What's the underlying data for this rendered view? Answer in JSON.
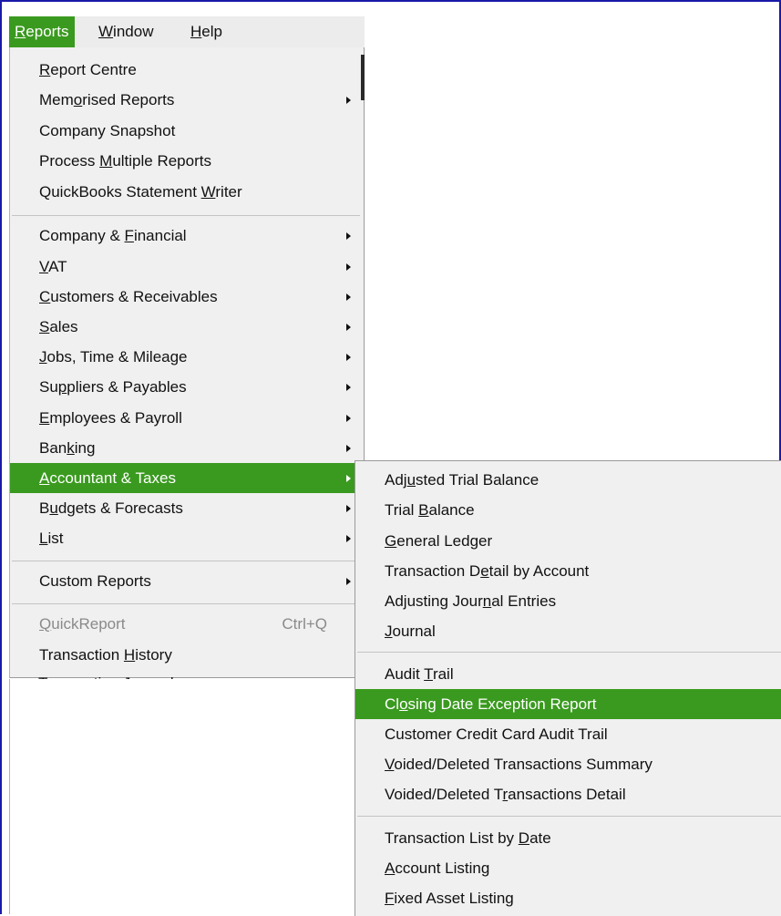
{
  "menubar": {
    "items": [
      {
        "pre": "",
        "u": "R",
        "post": "eports",
        "active": true
      },
      {
        "pre": "",
        "u": "W",
        "post": "indow",
        "active": false
      },
      {
        "pre": "",
        "u": "H",
        "post": "elp",
        "active": false
      }
    ]
  },
  "reports_menu": {
    "items": [
      {
        "pre": "",
        "u": "R",
        "post": "eport Centre",
        "submenu": false
      },
      {
        "pre": "Mem",
        "u": "o",
        "post": "rised Reports",
        "submenu": true
      },
      {
        "pre": "Company Snapshot",
        "u": "",
        "post": "",
        "submenu": false
      },
      {
        "pre": "Process ",
        "u": "M",
        "post": "ultiple Reports",
        "submenu": false
      },
      {
        "pre": "QuickBooks Statement ",
        "u": "W",
        "post": "riter",
        "submenu": false
      },
      {
        "pre": "Company & ",
        "u": "F",
        "post": "inancial",
        "submenu": true
      },
      {
        "pre": "",
        "u": "V",
        "post": "AT",
        "submenu": true
      },
      {
        "pre": "",
        "u": "C",
        "post": "ustomers & Receivables",
        "submenu": true
      },
      {
        "pre": "",
        "u": "S",
        "post": "ales",
        "submenu": true
      },
      {
        "pre": "",
        "u": "J",
        "post": "obs, Time & Mileage",
        "submenu": true
      },
      {
        "pre": "Su",
        "u": "p",
        "post": "pliers & Payables",
        "submenu": true
      },
      {
        "pre": "",
        "u": "E",
        "post": "mployees & Payroll",
        "submenu": true
      },
      {
        "pre": "Ban",
        "u": "k",
        "post": "ing",
        "submenu": true
      },
      {
        "pre": "",
        "u": "A",
        "post": "ccountant & Taxes",
        "submenu": true,
        "highlighted": true
      },
      {
        "pre": "B",
        "u": "u",
        "post": "dgets & Forecasts",
        "submenu": true
      },
      {
        "pre": "",
        "u": "L",
        "post": "ist",
        "submenu": true
      },
      {
        "pre": "Custom Reports",
        "u": "",
        "post": "",
        "submenu": true
      },
      {
        "pre": "",
        "u": "Q",
        "post": "uickReport",
        "submenu": false,
        "disabled": true,
        "shortcut": "Ctrl+Q"
      },
      {
        "pre": "Transaction ",
        "u": "H",
        "post": "istory",
        "submenu": false
      },
      {
        "pre": "Transactio",
        "u": "n",
        "post": " Journal",
        "submenu": false
      }
    ]
  },
  "accountant_submenu": {
    "items": [
      {
        "pre": "Adj",
        "u": "u",
        "post": "sted Trial Balance"
      },
      {
        "pre": "Trial ",
        "u": "B",
        "post": "alance"
      },
      {
        "pre": "",
        "u": "G",
        "post": "eneral Ledger"
      },
      {
        "pre": "Transaction D",
        "u": "e",
        "post": "tail by Account"
      },
      {
        "pre": "Adjusting Jour",
        "u": "n",
        "post": "al Entries"
      },
      {
        "pre": "",
        "u": "J",
        "post": "ournal"
      },
      {
        "pre": "Audit ",
        "u": "T",
        "post": "rail"
      },
      {
        "pre": "Cl",
        "u": "o",
        "post": "sing Date Exception Report",
        "highlighted": true
      },
      {
        "pre": "Customer Credit Card Audit Trail",
        "u": "",
        "post": ""
      },
      {
        "pre": "",
        "u": "V",
        "post": "oided/Deleted Transactions Summary"
      },
      {
        "pre": "Voided/Deleted T",
        "u": "r",
        "post": "ansactions Detail"
      },
      {
        "pre": "Transaction List by ",
        "u": "D",
        "post": "ate"
      },
      {
        "pre": "",
        "u": "A",
        "post": "ccount Listing"
      },
      {
        "pre": "",
        "u": "F",
        "post": "ixed Asset Listing"
      }
    ]
  },
  "colors": {
    "highlight": "#3a9a1f",
    "menu_bg": "#f0f0f0",
    "frame": "#1a1aa8"
  }
}
